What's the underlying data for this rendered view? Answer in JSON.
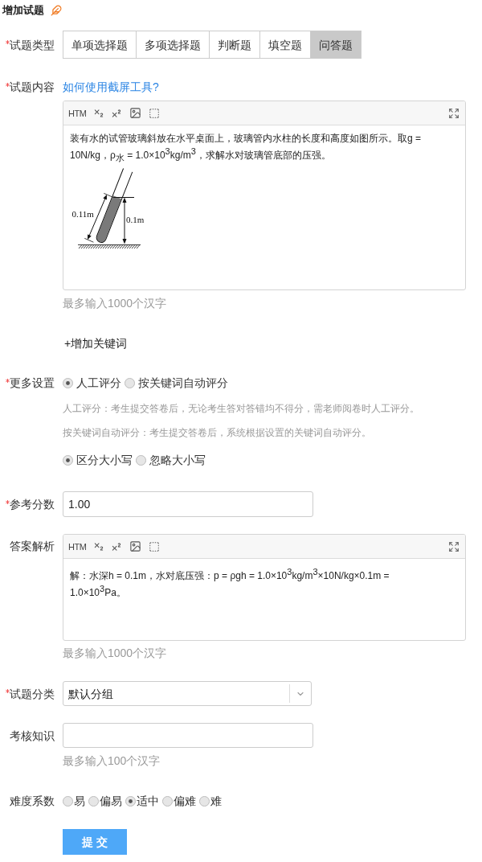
{
  "page_title": "增加试题",
  "question_type": {
    "label": "试题类型",
    "required": true,
    "tabs": [
      {
        "label": "单项选择题",
        "selected": false
      },
      {
        "label": "多项选择题",
        "selected": false
      },
      {
        "label": "判断题",
        "selected": false
      },
      {
        "label": "填空题",
        "selected": false
      },
      {
        "label": "问答题",
        "selected": true
      }
    ]
  },
  "question_content": {
    "label": "试题内容",
    "required": true,
    "help_link": "如何使用截屏工具?",
    "editor": {
      "toolbar_button": "HTM",
      "text": "装有水的试管玻璃斜放在水平桌面上，玻璃管内水柱的长度和高度如图所示。取g = 10N/kg，ρ$_{水}$ = 1.0×10$^{3}$kg/m$^{3}$，求解水对玻璃管底部的压强。",
      "figure": {
        "length_label": "0.11m",
        "height_label": "0.1m"
      }
    },
    "hint": "最多输入1000个汉字"
  },
  "add_keyword_link": "+增加关键词",
  "more_settings": {
    "label": "更多设置",
    "required": true,
    "scoring_options": [
      {
        "label": "人工评分",
        "selected": true
      },
      {
        "label": "按关键词自动评分",
        "selected": false
      }
    ],
    "notes": [
      "人工评分：考生提交答卷后，无论考生答对答错均不得分，需老师阅卷时人工评分。",
      "按关键词自动评分：考生提交答卷后，系统根据设置的关键词自动评分。"
    ],
    "case_options": [
      {
        "label": "区分大小写",
        "selected": true
      },
      {
        "label": "忽略大小写",
        "selected": false
      }
    ]
  },
  "reference_score": {
    "label": "参考分数",
    "required": true,
    "value": "1.00"
  },
  "answer_analysis": {
    "label": "答案解析",
    "required": false,
    "editor": {
      "toolbar_button": "HTM",
      "text": "解：水深h = 0.1m，水对底压强：p = ρgh = 1.0×10$^{3}$kg/m$^{3}$×10N/kg×0.1m = 1.0×10$^{3}$Pa。"
    },
    "hint": "最多输入1000个汉字"
  },
  "category": {
    "label": "试题分类",
    "required": true,
    "value": "默认分组"
  },
  "knowledge": {
    "label": "考核知识",
    "required": false,
    "hint": "最多输入100个汉字"
  },
  "difficulty": {
    "label": "难度系数",
    "required": false,
    "options": [
      {
        "label": "易",
        "selected": false
      },
      {
        "label": "偏易",
        "selected": false
      },
      {
        "label": "适中",
        "selected": true
      },
      {
        "label": "偏难",
        "selected": false
      },
      {
        "label": "难",
        "selected": false
      }
    ]
  },
  "submit_button": "提 交"
}
